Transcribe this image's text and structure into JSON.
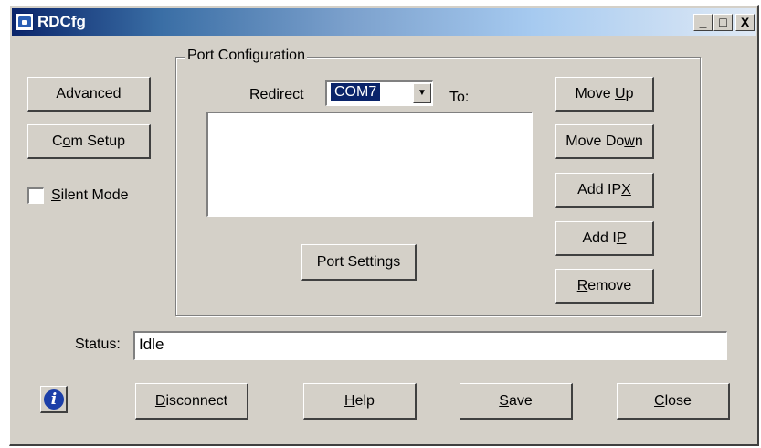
{
  "window": {
    "title": "RDCfg",
    "controls": {
      "minimize": "_",
      "maximize": "□",
      "close": "X"
    }
  },
  "left_panel": {
    "advanced_button": "Advanced",
    "com_setup_button": {
      "pre": "C",
      "ul": "o",
      "post": "m Setup"
    },
    "silent_mode": {
      "ul": "S",
      "post": "ilent Mode",
      "checked": false
    }
  },
  "port_configuration": {
    "legend": "Port Configuration",
    "redirect_label": "Redirect",
    "redirect_value": "COM7",
    "to_label": "To:",
    "port_settings_button": "Port Settings",
    "move_up_button": {
      "pre": "Move ",
      "ul": "U",
      "post": "p"
    },
    "move_down_button": {
      "pre": "Move Do",
      "ul": "w",
      "post": "n"
    },
    "add_ipx_button": {
      "pre": "Add IP",
      "ul": "X",
      "post": ""
    },
    "add_ip_button": {
      "pre": "Add I",
      "ul": "P",
      "post": ""
    },
    "remove_button": {
      "pre": "",
      "ul": "R",
      "post": "emove"
    }
  },
  "status": {
    "label": "Status:",
    "value": "Idle"
  },
  "bottom_bar": {
    "info_glyph": "i",
    "disconnect_button": {
      "pre": "",
      "ul": "D",
      "post": "isconnect"
    },
    "help_button": {
      "pre": "",
      "ul": "H",
      "post": "elp"
    },
    "save_button": {
      "pre": "",
      "ul": "S",
      "post": "ave"
    },
    "close_button": {
      "pre": "",
      "ul": "C",
      "post": "lose"
    }
  },
  "icons": {
    "app": "app-icon",
    "dropdown": "chevron-down-icon",
    "info": "info-icon"
  },
  "colors": {
    "face": "#d4d0c8",
    "title_start": "#0a246a",
    "title_end": "#dfe9f5",
    "selection": "#0a246a"
  }
}
